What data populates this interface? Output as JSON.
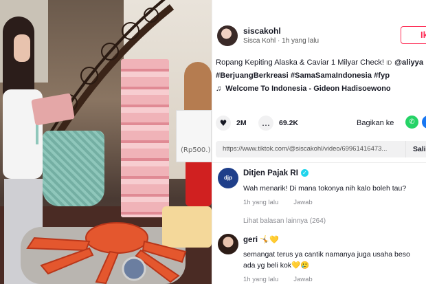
{
  "video": {
    "sign_text": "(Rp500.)"
  },
  "author": {
    "username": "siscakohl",
    "display_name": "Sisca Kohl",
    "time": "1h yang lalu",
    "separator": " · ",
    "follow_label": "Ikuti"
  },
  "description": {
    "text": "Ropang Kepiting Alaska & Caviar 1 Milyar Check! ",
    "id_label": "ID",
    "mention": "@aliyya",
    "hashtags": "#BerjuangBerkreasi #SamaSamaIndonesia #fyp"
  },
  "music": {
    "title": "Welcome To Indonesia - Gideon Hadisoewono"
  },
  "actions": {
    "likes": "2M",
    "comments": "69.2K",
    "share_label": "Bagikan ke"
  },
  "link": {
    "url": "https://www.tiktok.com/@siscakohl/video/69961416473...",
    "copy_label": "Salin"
  },
  "comments": [
    {
      "name": "Ditjen Pajak RI",
      "avatar_text": "djp",
      "text": "Wah menarik! Di mana tokonya nih kalo boleh tau?",
      "time": "1h yang lalu",
      "reply_label": "Jawab",
      "more_replies": "Lihat balasan lainnya (264)"
    },
    {
      "name": "geri",
      "name_emoji": "🤸💛",
      "text_line1": "semangat terus ya cantik namanya juga usaha beso",
      "text_line2": "ada yg beli kok💛🥲",
      "time": "1h yang lalu",
      "reply_label": "Jawab"
    }
  ],
  "icons": {
    "like": "heart-icon",
    "comment": "comment-icon",
    "music": "music-note-icon",
    "whatsapp": "whatsapp-icon",
    "facebook": "facebook-icon",
    "verified": "verified-icon"
  },
  "colors": {
    "accent": "#fe2c55",
    "verified": "#20d5ec",
    "whatsapp": "#25d366",
    "facebook": "#1877f2"
  }
}
